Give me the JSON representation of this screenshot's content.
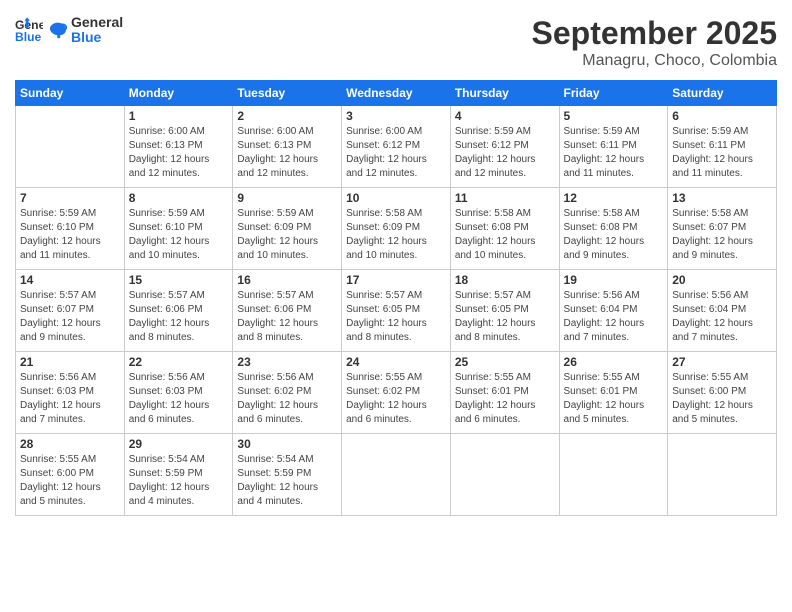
{
  "header": {
    "logo_line1": "General",
    "logo_line2": "Blue",
    "month": "September 2025",
    "location": "Managru, Choco, Colombia"
  },
  "days_of_week": [
    "Sunday",
    "Monday",
    "Tuesday",
    "Wednesday",
    "Thursday",
    "Friday",
    "Saturday"
  ],
  "weeks": [
    [
      {
        "day": "",
        "sunrise": "",
        "sunset": "",
        "daylight": ""
      },
      {
        "day": "1",
        "sunrise": "Sunrise: 6:00 AM",
        "sunset": "Sunset: 6:13 PM",
        "daylight": "Daylight: 12 hours and 12 minutes."
      },
      {
        "day": "2",
        "sunrise": "Sunrise: 6:00 AM",
        "sunset": "Sunset: 6:13 PM",
        "daylight": "Daylight: 12 hours and 12 minutes."
      },
      {
        "day": "3",
        "sunrise": "Sunrise: 6:00 AM",
        "sunset": "Sunset: 6:12 PM",
        "daylight": "Daylight: 12 hours and 12 minutes."
      },
      {
        "day": "4",
        "sunrise": "Sunrise: 5:59 AM",
        "sunset": "Sunset: 6:12 PM",
        "daylight": "Daylight: 12 hours and 12 minutes."
      },
      {
        "day": "5",
        "sunrise": "Sunrise: 5:59 AM",
        "sunset": "Sunset: 6:11 PM",
        "daylight": "Daylight: 12 hours and 11 minutes."
      },
      {
        "day": "6",
        "sunrise": "Sunrise: 5:59 AM",
        "sunset": "Sunset: 6:11 PM",
        "daylight": "Daylight: 12 hours and 11 minutes."
      }
    ],
    [
      {
        "day": "7",
        "sunrise": "Sunrise: 5:59 AM",
        "sunset": "Sunset: 6:10 PM",
        "daylight": "Daylight: 12 hours and 11 minutes."
      },
      {
        "day": "8",
        "sunrise": "Sunrise: 5:59 AM",
        "sunset": "Sunset: 6:10 PM",
        "daylight": "Daylight: 12 hours and 10 minutes."
      },
      {
        "day": "9",
        "sunrise": "Sunrise: 5:59 AM",
        "sunset": "Sunset: 6:09 PM",
        "daylight": "Daylight: 12 hours and 10 minutes."
      },
      {
        "day": "10",
        "sunrise": "Sunrise: 5:58 AM",
        "sunset": "Sunset: 6:09 PM",
        "daylight": "Daylight: 12 hours and 10 minutes."
      },
      {
        "day": "11",
        "sunrise": "Sunrise: 5:58 AM",
        "sunset": "Sunset: 6:08 PM",
        "daylight": "Daylight: 12 hours and 10 minutes."
      },
      {
        "day": "12",
        "sunrise": "Sunrise: 5:58 AM",
        "sunset": "Sunset: 6:08 PM",
        "daylight": "Daylight: 12 hours and 9 minutes."
      },
      {
        "day": "13",
        "sunrise": "Sunrise: 5:58 AM",
        "sunset": "Sunset: 6:07 PM",
        "daylight": "Daylight: 12 hours and 9 minutes."
      }
    ],
    [
      {
        "day": "14",
        "sunrise": "Sunrise: 5:57 AM",
        "sunset": "Sunset: 6:07 PM",
        "daylight": "Daylight: 12 hours and 9 minutes."
      },
      {
        "day": "15",
        "sunrise": "Sunrise: 5:57 AM",
        "sunset": "Sunset: 6:06 PM",
        "daylight": "Daylight: 12 hours and 8 minutes."
      },
      {
        "day": "16",
        "sunrise": "Sunrise: 5:57 AM",
        "sunset": "Sunset: 6:06 PM",
        "daylight": "Daylight: 12 hours and 8 minutes."
      },
      {
        "day": "17",
        "sunrise": "Sunrise: 5:57 AM",
        "sunset": "Sunset: 6:05 PM",
        "daylight": "Daylight: 12 hours and 8 minutes."
      },
      {
        "day": "18",
        "sunrise": "Sunrise: 5:57 AM",
        "sunset": "Sunset: 6:05 PM",
        "daylight": "Daylight: 12 hours and 8 minutes."
      },
      {
        "day": "19",
        "sunrise": "Sunrise: 5:56 AM",
        "sunset": "Sunset: 6:04 PM",
        "daylight": "Daylight: 12 hours and 7 minutes."
      },
      {
        "day": "20",
        "sunrise": "Sunrise: 5:56 AM",
        "sunset": "Sunset: 6:04 PM",
        "daylight": "Daylight: 12 hours and 7 minutes."
      }
    ],
    [
      {
        "day": "21",
        "sunrise": "Sunrise: 5:56 AM",
        "sunset": "Sunset: 6:03 PM",
        "daylight": "Daylight: 12 hours and 7 minutes."
      },
      {
        "day": "22",
        "sunrise": "Sunrise: 5:56 AM",
        "sunset": "Sunset: 6:03 PM",
        "daylight": "Daylight: 12 hours and 6 minutes."
      },
      {
        "day": "23",
        "sunrise": "Sunrise: 5:56 AM",
        "sunset": "Sunset: 6:02 PM",
        "daylight": "Daylight: 12 hours and 6 minutes."
      },
      {
        "day": "24",
        "sunrise": "Sunrise: 5:55 AM",
        "sunset": "Sunset: 6:02 PM",
        "daylight": "Daylight: 12 hours and 6 minutes."
      },
      {
        "day": "25",
        "sunrise": "Sunrise: 5:55 AM",
        "sunset": "Sunset: 6:01 PM",
        "daylight": "Daylight: 12 hours and 6 minutes."
      },
      {
        "day": "26",
        "sunrise": "Sunrise: 5:55 AM",
        "sunset": "Sunset: 6:01 PM",
        "daylight": "Daylight: 12 hours and 5 minutes."
      },
      {
        "day": "27",
        "sunrise": "Sunrise: 5:55 AM",
        "sunset": "Sunset: 6:00 PM",
        "daylight": "Daylight: 12 hours and 5 minutes."
      }
    ],
    [
      {
        "day": "28",
        "sunrise": "Sunrise: 5:55 AM",
        "sunset": "Sunset: 6:00 PM",
        "daylight": "Daylight: 12 hours and 5 minutes."
      },
      {
        "day": "29",
        "sunrise": "Sunrise: 5:54 AM",
        "sunset": "Sunset: 5:59 PM",
        "daylight": "Daylight: 12 hours and 4 minutes."
      },
      {
        "day": "30",
        "sunrise": "Sunrise: 5:54 AM",
        "sunset": "Sunset: 5:59 PM",
        "daylight": "Daylight: 12 hours and 4 minutes."
      },
      {
        "day": "",
        "sunrise": "",
        "sunset": "",
        "daylight": ""
      },
      {
        "day": "",
        "sunrise": "",
        "sunset": "",
        "daylight": ""
      },
      {
        "day": "",
        "sunrise": "",
        "sunset": "",
        "daylight": ""
      },
      {
        "day": "",
        "sunrise": "",
        "sunset": "",
        "daylight": ""
      }
    ]
  ]
}
